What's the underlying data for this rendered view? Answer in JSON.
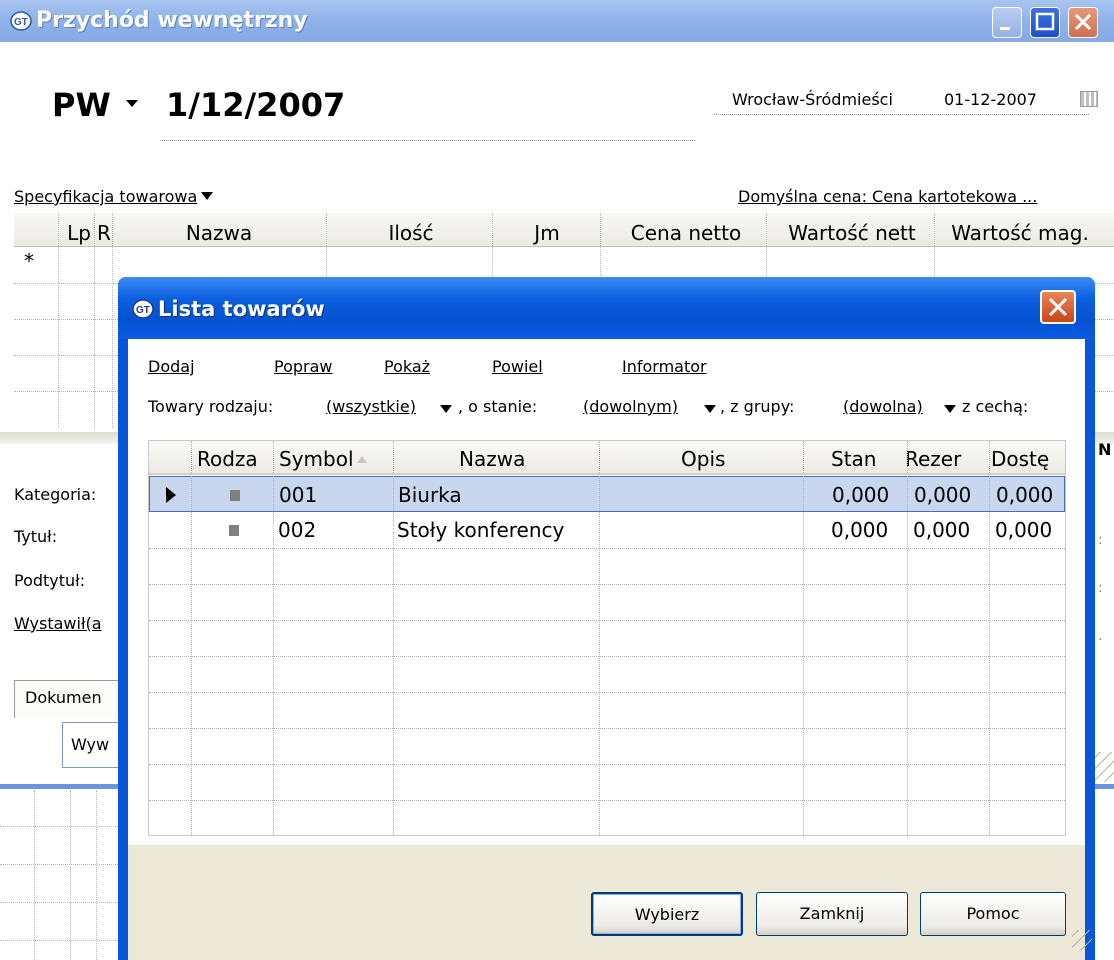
{
  "window": {
    "title": "Przychód wewnętrzny"
  },
  "header": {
    "doc_type": "PW",
    "doc_number": "1/12/2007",
    "branch": "Wrocław-Śródmieści",
    "date": "01-12-2007"
  },
  "spec": {
    "menu_label": "Specyfikacja towarowa",
    "price_link": "Domyślna cena: Cena kartotekowa ...",
    "columns": [
      "Lp",
      "R",
      "Nazwa",
      "Ilość",
      "Jm",
      "Cena netto",
      "Wartość nett",
      "Wartość mag."
    ],
    "new_row_marker": "*"
  },
  "form": {
    "labels": [
      "Kategoria:",
      "Tytuł:",
      "Podtytuł:",
      "Wystawił(a"
    ],
    "tab_label": "Dokumen",
    "field_value": "Wyw",
    "overflow_marker": "N"
  },
  "dialog": {
    "title": "Lista towarów",
    "actions": [
      "Dodaj",
      "Popraw",
      "Pokaż",
      "Powiel",
      "Informator"
    ],
    "filter": {
      "label_kind": "Towary rodzaju:",
      "kind": "(wszystkie)",
      "label_state": ", o stanie:",
      "state": "(dowolnym)",
      "label_group": ", z grupy:",
      "group": "(dowolna)",
      "label_feature": "z cechą:"
    },
    "columns": [
      "Rodza",
      "Symbol",
      "Nazwa",
      "Opis",
      "Stan",
      "Rezer",
      "Dostę"
    ],
    "rows": [
      {
        "symbol": "001",
        "name": "Biurka",
        "desc": "",
        "stan": "0,000",
        "rezer": "0,000",
        "dost": "0,000"
      },
      {
        "symbol": "002",
        "name": "Stoły konferency",
        "desc": "",
        "stan": "0,000",
        "rezer": "0,000",
        "dost": "0,000"
      }
    ],
    "buttons": {
      "select": "Wybierz",
      "close": "Zamknij",
      "help": "Pomoc"
    }
  },
  "colors": {
    "titlebar": "#90b2ea",
    "dialog_titlebar": "#0552d2",
    "selection": "#c8d6ee"
  },
  "icons": [
    "app-icon",
    "minimize-icon",
    "maximize-icon",
    "close-icon",
    "calendar-icon",
    "row-pointer-icon",
    "sort-icon"
  ]
}
